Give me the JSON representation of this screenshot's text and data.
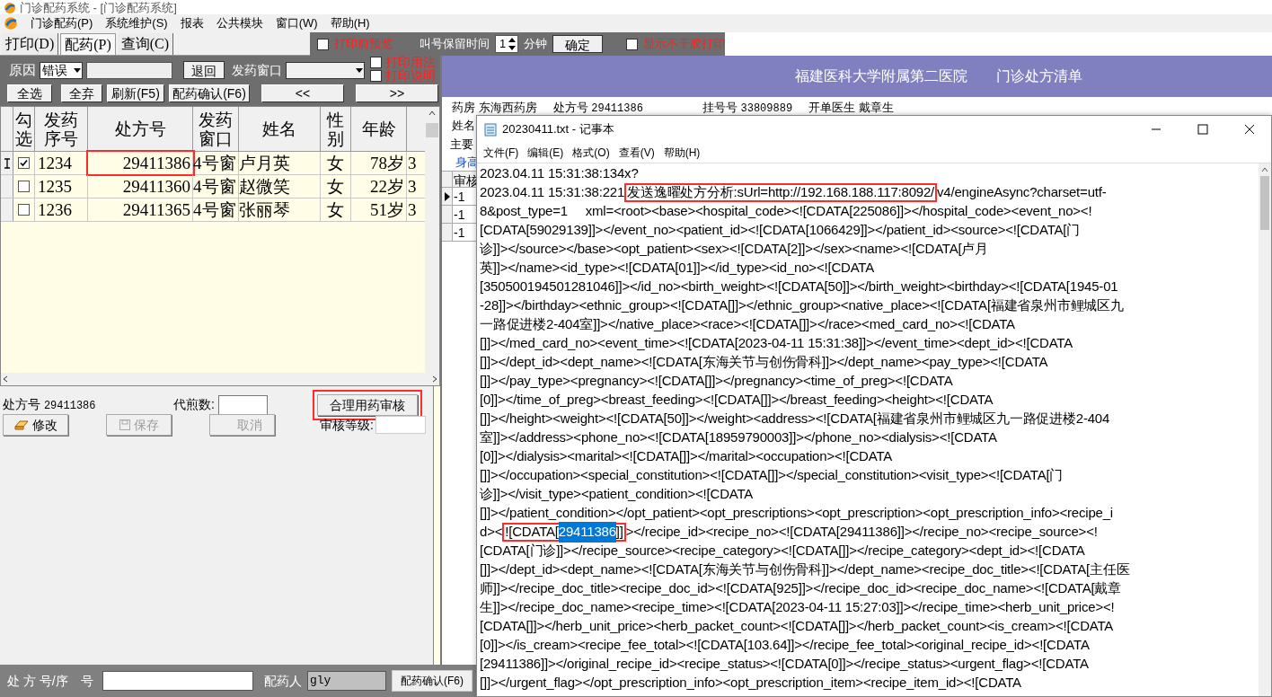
{
  "app_title": "门诊配药系统 - [门诊配药系统]",
  "menu": [
    "门诊配药(P)",
    "系统维护(S)",
    "报表",
    "公共模块",
    "窗口(W)",
    "帮助(H)"
  ],
  "tabs": [
    {
      "label": "打印(D)",
      "selected": false
    },
    {
      "label": "配药(P)",
      "selected": true
    },
    {
      "label": "查询(C)",
      "selected": false
    }
  ],
  "toolbar": {
    "preview": {
      "label": "打印前预览",
      "checked": false
    },
    "hold_label": "叫号保留时间",
    "hold_value": "1",
    "hold_unit": "分钟",
    "confirm": "确定",
    "sticker": {
      "label": "显示不干胶打印",
      "checked": false
    }
  },
  "filters": {
    "reason_label": "原因",
    "reason_value": "错误",
    "return_button": "退回",
    "window_label": "发药窗口",
    "print_usage": {
      "label": "打印用法",
      "checked": false
    },
    "print_notes": {
      "label": "打印说明",
      "checked": false
    }
  },
  "actions": [
    "全选",
    "全弃",
    "刷新(F5)",
    "配药确认(F6)",
    "<<",
    ">>"
  ],
  "table": {
    "columns": [
      "勾选",
      "发药序号",
      "处方号",
      "发药窗口",
      "姓名",
      "性别",
      "年龄"
    ],
    "rows": [
      {
        "current": true,
        "checked": true,
        "seq": "1234",
        "recipe_no": "29411386",
        "recipe_no_boxed": true,
        "window": "4号窗",
        "name": "卢月英",
        "sex": "女",
        "age": "78岁",
        "column_9": "3"
      },
      {
        "current": false,
        "checked": false,
        "seq": "1235",
        "recipe_no": "29411360",
        "recipe_no_boxed": false,
        "window": "4号窗",
        "name": "赵微笑",
        "sex": "女",
        "age": "22岁",
        "column_9": "3"
      },
      {
        "current": false,
        "checked": false,
        "seq": "1236",
        "recipe_no": "29411365",
        "recipe_no_boxed": false,
        "window": "4号窗",
        "name": "张丽琴",
        "sex": "女",
        "age": "51岁",
        "column_9": "3"
      }
    ]
  },
  "form": {
    "recipe_label": "处方号",
    "recipe_value": "29411386",
    "decoct_label": "代煎数:",
    "audit_button": {
      "label": "合理用药审核",
      "boxed": true
    },
    "edit_button": {
      "label": "修改",
      "disabled": false
    },
    "save_button": {
      "label": "保存",
      "disabled": true
    },
    "cancel_button": {
      "label": "取消",
      "disabled": true
    },
    "level_label": "审核等级:"
  },
  "bottom_bar": {
    "recipe_label": "处 方 号/序　号",
    "dispenser_label": "配药人",
    "dispenser_value": "gly",
    "confirm_button": "配药确认(F6)"
  },
  "report": {
    "title": "福建医科大学附属第二医院　　门诊处方清单",
    "info": [
      {
        "label": "药房",
        "value": "东海西药房"
      },
      {
        "label": "处方号",
        "value": "29411386"
      },
      {
        "label": "挂号号",
        "value": "33809889"
      },
      {
        "label": "开单医生",
        "value": "戴章生"
      }
    ],
    "name_label": "姓名",
    "diagnosis_label": "主要",
    "height_label": "身高",
    "grid_header": "审核",
    "grid_rows": [
      {
        "value": "-1",
        "current": true
      },
      {
        "value": "-1",
        "current": false
      },
      {
        "value": "-1",
        "current": false
      }
    ]
  },
  "notepad": {
    "title": "20230411.txt - 记事本",
    "menu": [
      "文件(F)",
      "编辑(E)",
      "格式(O)",
      "查看(V)",
      "帮助(H)"
    ],
    "lines": [
      [
        {
          "text": "2023.04.11 15:31:38:134x?"
        }
      ],
      [
        {
          "text": "2023.04.11 15:31:38:221"
        },
        {
          "text": "发送逸曜处方分析:sUrl=http://192.168.188.117:8092/",
          "boxed": true
        },
        {
          "text": "v4/engineAsync?charset=utf-"
        }
      ],
      [
        {
          "text": "8&post_type=1     xml=<root><base><hospital_code><![CDATA[225086]]></hospital_code><event_no><!"
        }
      ],
      [
        {
          "text": "[CDATA[59029139]]></event_no><patient_id><![CDATA[1066429]]></patient_id><source><![CDATA[门"
        }
      ],
      [
        {
          "text": "诊]]></source></base><opt_patient><sex><![CDATA[2]]></sex><name><![CDATA[卢月"
        }
      ],
      [
        {
          "text": "英]]></name><id_type><![CDATA[01]]></id_type><id_no><![CDATA"
        }
      ],
      [
        {
          "text": "[350500194501281046]]></id_no><birth_weight><![CDATA[50]]></birth_weight><birthday><![CDATA[1945-01"
        }
      ],
      [
        {
          "text": "-28]]></birthday><ethnic_group><![CDATA[]]></ethnic_group><native_place><![CDATA[福建省泉州市鲤城区九"
        }
      ],
      [
        {
          "text": "一路促进楼2-404室]]></native_place><race><![CDATA[]]></race><med_card_no><![CDATA"
        }
      ],
      [
        {
          "text": "[]]></med_card_no><event_time><![CDATA[2023-04-11 15:31:38]]></event_time><dept_id><![CDATA"
        }
      ],
      [
        {
          "text": "[]]></dept_id><dept_name><![CDATA[东海关节与创伤骨科]]></dept_name><pay_type><![CDATA"
        }
      ],
      [
        {
          "text": "[]]></pay_type><pregnancy><![CDATA[]]></pregnancy><time_of_preg><![CDATA"
        }
      ],
      [
        {
          "text": "[0]]></time_of_preg><breast_feeding><![CDATA[]]></breast_feeding><height><![CDATA"
        }
      ],
      [
        {
          "text": "[]]></height><weight><![CDATA[50]]></weight><address><![CDATA[福建省泉州市鲤城区九一路促进楼2-404"
        }
      ],
      [
        {
          "text": "室]]></address><phone_no><![CDATA[18959790003]]></phone_no><dialysis><![CDATA"
        }
      ],
      [
        {
          "text": "[0]]></dialysis><marital><![CDATA[]]></marital><occupation><![CDATA"
        }
      ],
      [
        {
          "text": "[]]></occupation><special_constitution><![CDATA[]]></special_constitution><visit_type><![CDATA[门"
        }
      ],
      [
        {
          "text": "诊]]></visit_type><patient_condition><![CDATA"
        }
      ],
      [
        {
          "text": "[]]></patient_condition></opt_patient><opt_prescriptions><opt_prescription><opt_prescription_info><recipe_i"
        }
      ],
      [
        {
          "text": "d><"
        },
        {
          "text": "![CDATA[",
          "boxed": true
        },
        {
          "text": "29411386",
          "boxed": true,
          "selected": true
        },
        {
          "text": "]]",
          "boxed": true
        },
        {
          "text": "></recipe_id><recipe_no><![CDATA[29411386]]></recipe_no><recipe_source><!"
        }
      ],
      [
        {
          "text": "[CDATA[门诊]]></recipe_source><recipe_category><![CDATA[]]></recipe_category><dept_id><![CDATA"
        }
      ],
      [
        {
          "text": "[]]></dept_id><dept_name><![CDATA[东海关节与创伤骨科]]></dept_name><recipe_doc_title><![CDATA[主任医"
        }
      ],
      [
        {
          "text": "师]]></recipe_doc_title><recipe_doc_id><![CDATA[925]]></recipe_doc_id><recipe_doc_name><![CDATA[戴章"
        }
      ],
      [
        {
          "text": "生]]></recipe_doc_name><recipe_time><![CDATA[2023-04-11 15:27:03]]></recipe_time><herb_unit_price><!"
        }
      ],
      [
        {
          "text": "[CDATA[]]></herb_unit_price><herb_packet_count><![CDATA[]]></herb_packet_count><is_cream><![CDATA"
        }
      ],
      [
        {
          "text": "[0]]></is_cream><recipe_fee_total><![CDATA[103.64]]></recipe_fee_total><original_recipe_id><![CDATA"
        }
      ],
      [
        {
          "text": "[29411386]]></original_recipe_id><recipe_status><![CDATA[0]]></recipe_status><urgent_flag><![CDATA"
        }
      ],
      [
        {
          "text": "[]]></urgent_flag></opt_prescription_info><opt_prescription_item><recipe_item_id><![CDATA"
        }
      ]
    ]
  }
}
